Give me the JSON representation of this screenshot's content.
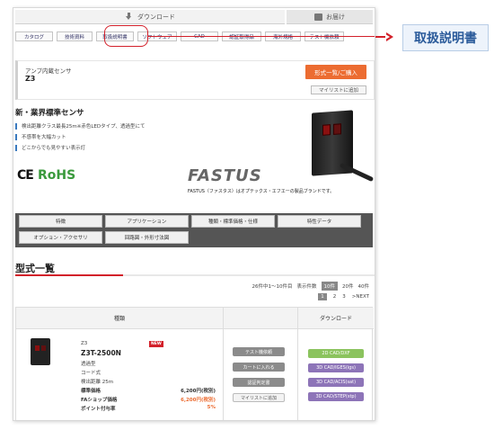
{
  "header": {
    "download_label": "ダウンロード",
    "delivery_label": "お届け"
  },
  "tabs": [
    "カタログ",
    "技術資料",
    "取扱説明書",
    "ソフトウェア",
    "CAD",
    "認証取得品",
    "海外規格",
    "テスト機依頼"
  ],
  "product": {
    "category": "アンプ内蔵センサ",
    "name": "Z3",
    "buy_button": "形式一覧/ご購入",
    "mylist_button": "マイリストに追加",
    "headline": "新・業界標準センサ",
    "features": [
      "検出距離クラス最長25m※赤色LEDタイプ、透過型にて",
      "不感帯を大幅カット",
      "どこからでも見やすい表示灯"
    ],
    "cert_ce": "CE",
    "cert_rohs": "RoHS",
    "brand": "FASTUS",
    "brand_note": "FASTUS（ファスタス）はオプテックス・エフエーの製品ブランドです。"
  },
  "nav": {
    "row1": [
      "特徴",
      "アプリケーション",
      "種類・標準価格・仕様",
      "特性データ"
    ],
    "row2": [
      "オプション・アクセサリ",
      "回路図・外形寸法図"
    ]
  },
  "models": {
    "title": "型式一覧",
    "count_text": "26件中1〜10件目",
    "per_page_label": "表示件数",
    "per_page_options": [
      "10件",
      "20件",
      "40件"
    ],
    "pages": [
      "1",
      "2",
      "3",
      ">NEXT"
    ],
    "col_type": "種類",
    "col_download": "ダウンロード",
    "row": {
      "series": "Z3",
      "badge": "NEW",
      "model": "Z3T-2500N",
      "spec1": "透過型",
      "spec2": "コード式",
      "spec3": "検出距離 25m",
      "std_price_label": "標準価格",
      "std_price": "6,200円(税別)",
      "fa_price_label": "FAショップ価格",
      "fa_price": "6,200円(税別)",
      "points_label": "ポイント付与率",
      "points": "5%",
      "actions": [
        "テスト機依頼",
        "カートに入れる",
        "認証判定書",
        "マイリストに追加"
      ],
      "downloads": [
        "2D CAD/DXF",
        "3D CAD/IGES(igs)",
        "3D CAD/ACIS(sat)",
        "3D CAD/STEP(stp)"
      ]
    }
  },
  "callout": {
    "label": "取扱説明書"
  },
  "colors": {
    "accent_red": "#d3202a",
    "buy_orange": "#ec6c31",
    "rohs_green": "#3a9a3c",
    "download_green": "#8bc35e",
    "download_purple": "#8d74b8",
    "price_orange": "#ec6c31"
  }
}
